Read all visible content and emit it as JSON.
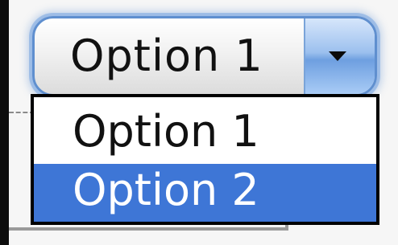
{
  "select": {
    "selected_value": "Option 1",
    "arrow_icon": "triangle-down"
  },
  "dropdown": {
    "options": [
      {
        "label": "Option 1",
        "highlighted": false
      },
      {
        "label": "Option 2",
        "highlighted": true
      }
    ]
  },
  "colors": {
    "focus_ring": "#5f8fcf",
    "highlight": "#3e76d6",
    "highlight_text": "#ffffff"
  }
}
